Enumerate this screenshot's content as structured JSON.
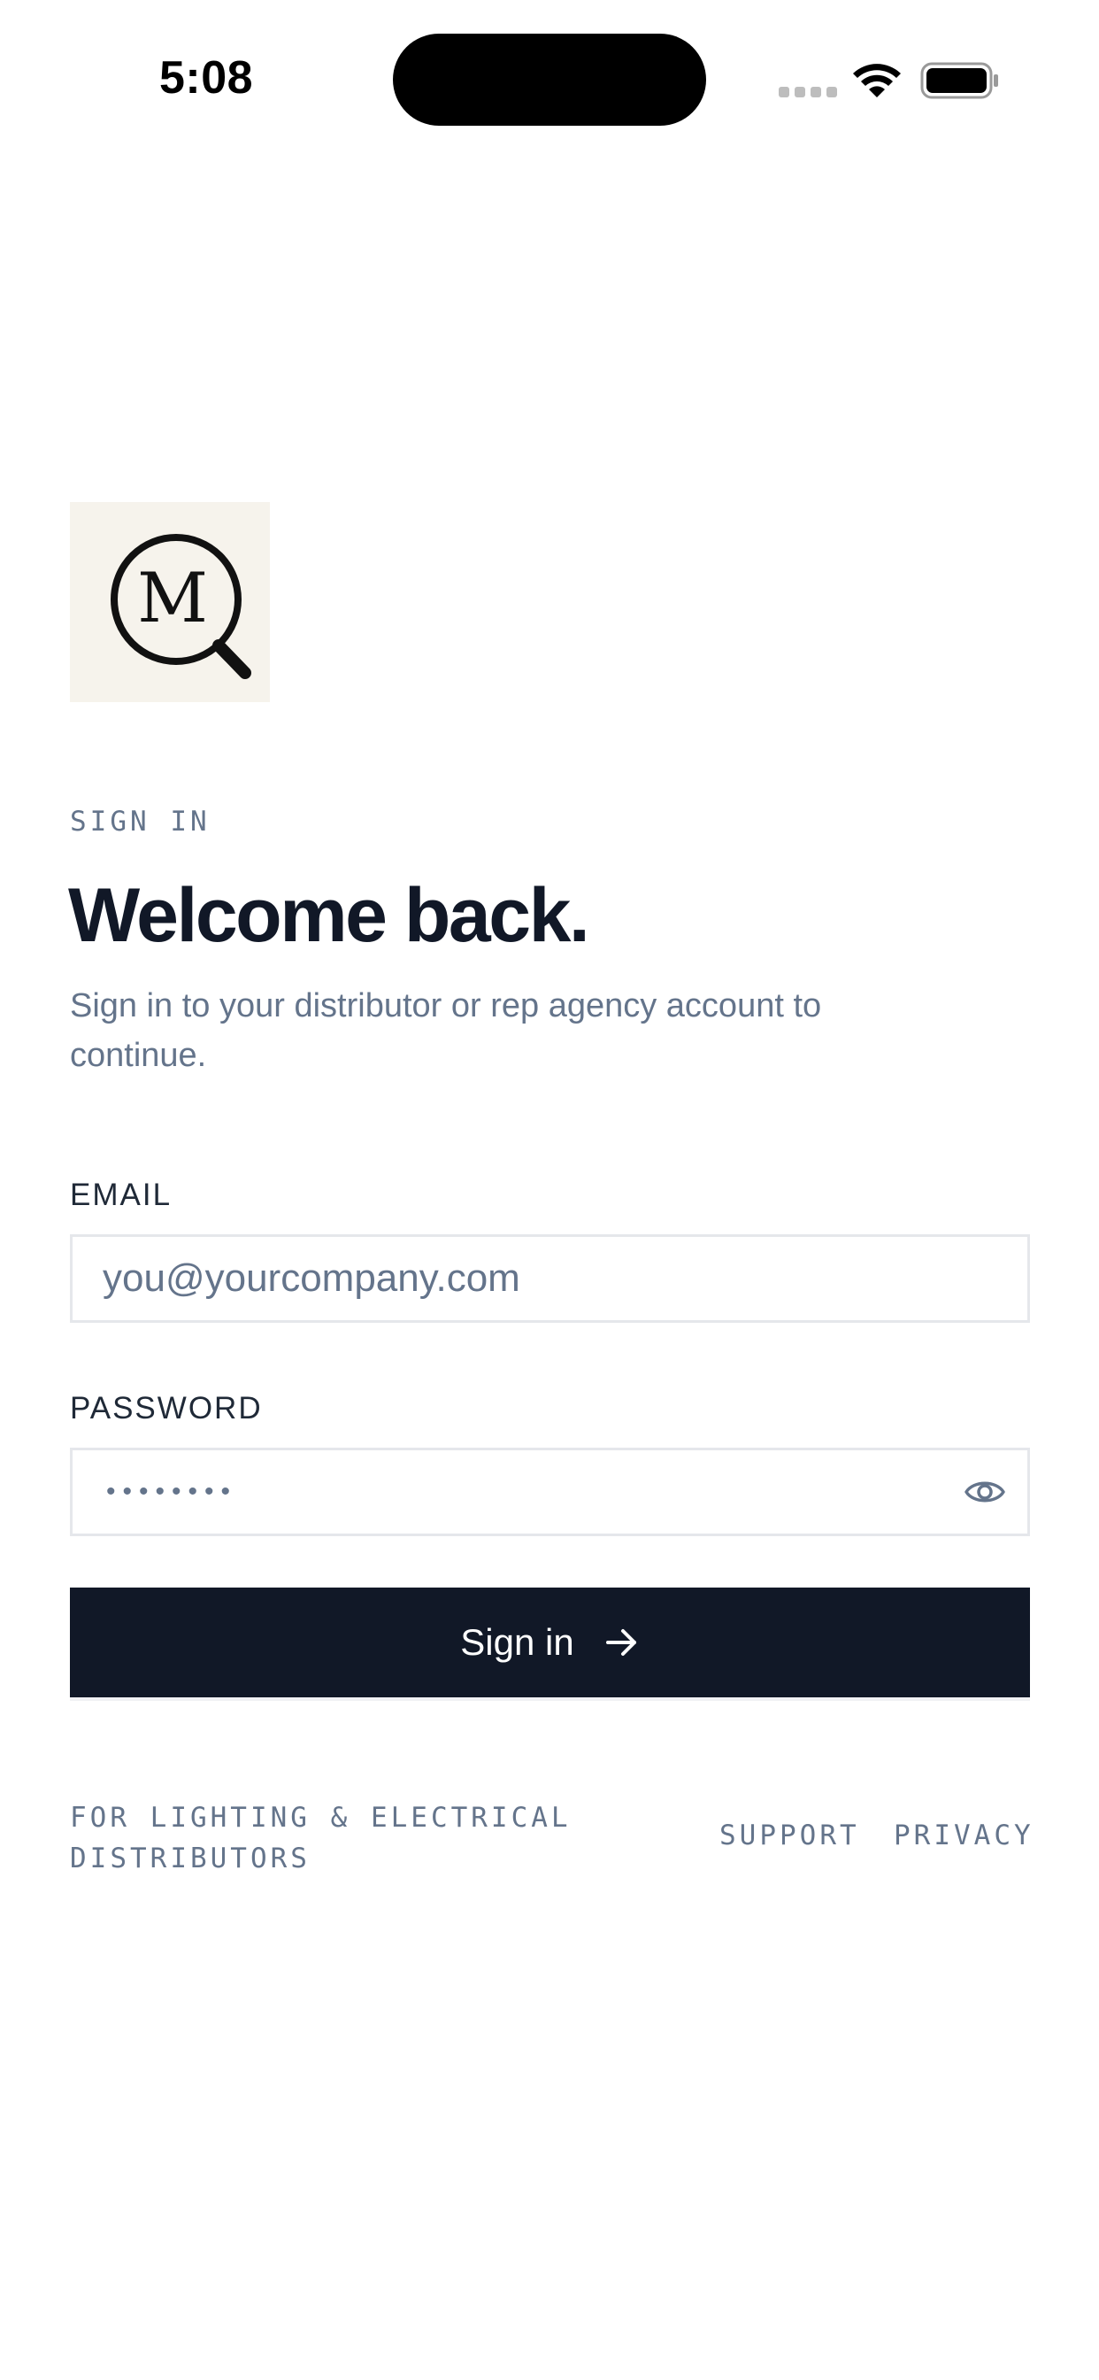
{
  "status_bar": {
    "time": "5:08"
  },
  "brand": {
    "logo_letter": "M",
    "logo_icon": "magnifier-icon",
    "logo_bg": "#f6f3ec"
  },
  "header": {
    "eyebrow": "SIGN IN",
    "title": "Welcome back.",
    "subtitle": "Sign in to your distributor or rep agency account to continue."
  },
  "form": {
    "email": {
      "label": "EMAIL",
      "value": "",
      "placeholder": "you@yourcompany.com"
    },
    "password": {
      "label": "PASSWORD",
      "masked_value": "••••••••",
      "toggle_icon": "eye-icon"
    },
    "submit": {
      "label": "Sign in",
      "icon": "arrow-right-icon"
    }
  },
  "footer": {
    "tagline": "FOR LIGHTING & ELECTRICAL DISTRIBUTORS",
    "links": [
      "SUPPORT",
      "PRIVACY"
    ]
  },
  "colors": {
    "primary": "#111827",
    "muted": "#64748b",
    "border": "#e5e7eb"
  }
}
